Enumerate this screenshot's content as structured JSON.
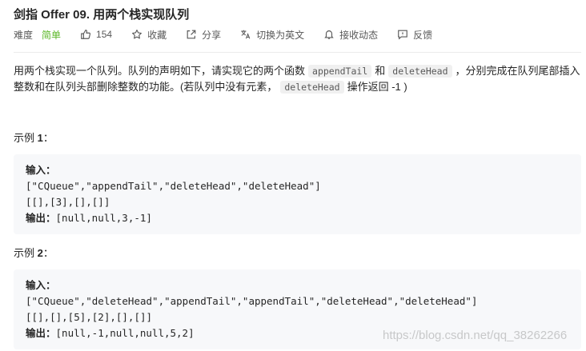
{
  "problem": {
    "title": "剑指 Offer 09. 用两个栈实现队列",
    "difficulty_label": "难度",
    "difficulty_value": "简单",
    "difficulty_color": "#5ab726"
  },
  "actions": {
    "like_count": "154",
    "favorite": "收藏",
    "share": "分享",
    "switch_lang": "切换为英文",
    "notify": "接收动态",
    "feedback": "反馈"
  },
  "description": {
    "part1": "用两个栈实现一个队列。队列的声明如下，请实现它的两个函数",
    "code1": "appendTail",
    "part2": "和",
    "code2": "deleteHead",
    "part3": "，分别完成在队列尾部插入整数和在队列头部删除整数的功能。(若队列中没有元素，",
    "code3": "deleteHead",
    "part4": "操作返回 -1 )"
  },
  "examples": [
    {
      "heading_prefix": "示例 ",
      "heading_num": "1",
      "heading_suffix": "：",
      "input_label": "输入：",
      "line1": "[\"CQueue\",\"appendTail\",\"deleteHead\",\"deleteHead\"]",
      "line2": "[[],[3],[],[]]",
      "output_label": "输出：",
      "output": "[null,null,3,-1]"
    },
    {
      "heading_prefix": "示例 ",
      "heading_num": "2",
      "heading_suffix": "：",
      "input_label": "输入：",
      "line1": "[\"CQueue\",\"deleteHead\",\"appendTail\",\"appendTail\",\"deleteHead\",\"deleteHead\"]",
      "line2": "[[],[],[5],[2],[],[]]",
      "output_label": "输出：",
      "output": "[null,-1,null,null,5,2]"
    }
  ],
  "watermark": "https://blog.csdn.net/qq_38262266",
  "icons": [
    "thumbs-up-icon",
    "star-icon",
    "share-icon",
    "translate-icon",
    "bell-icon",
    "feedback-icon"
  ]
}
